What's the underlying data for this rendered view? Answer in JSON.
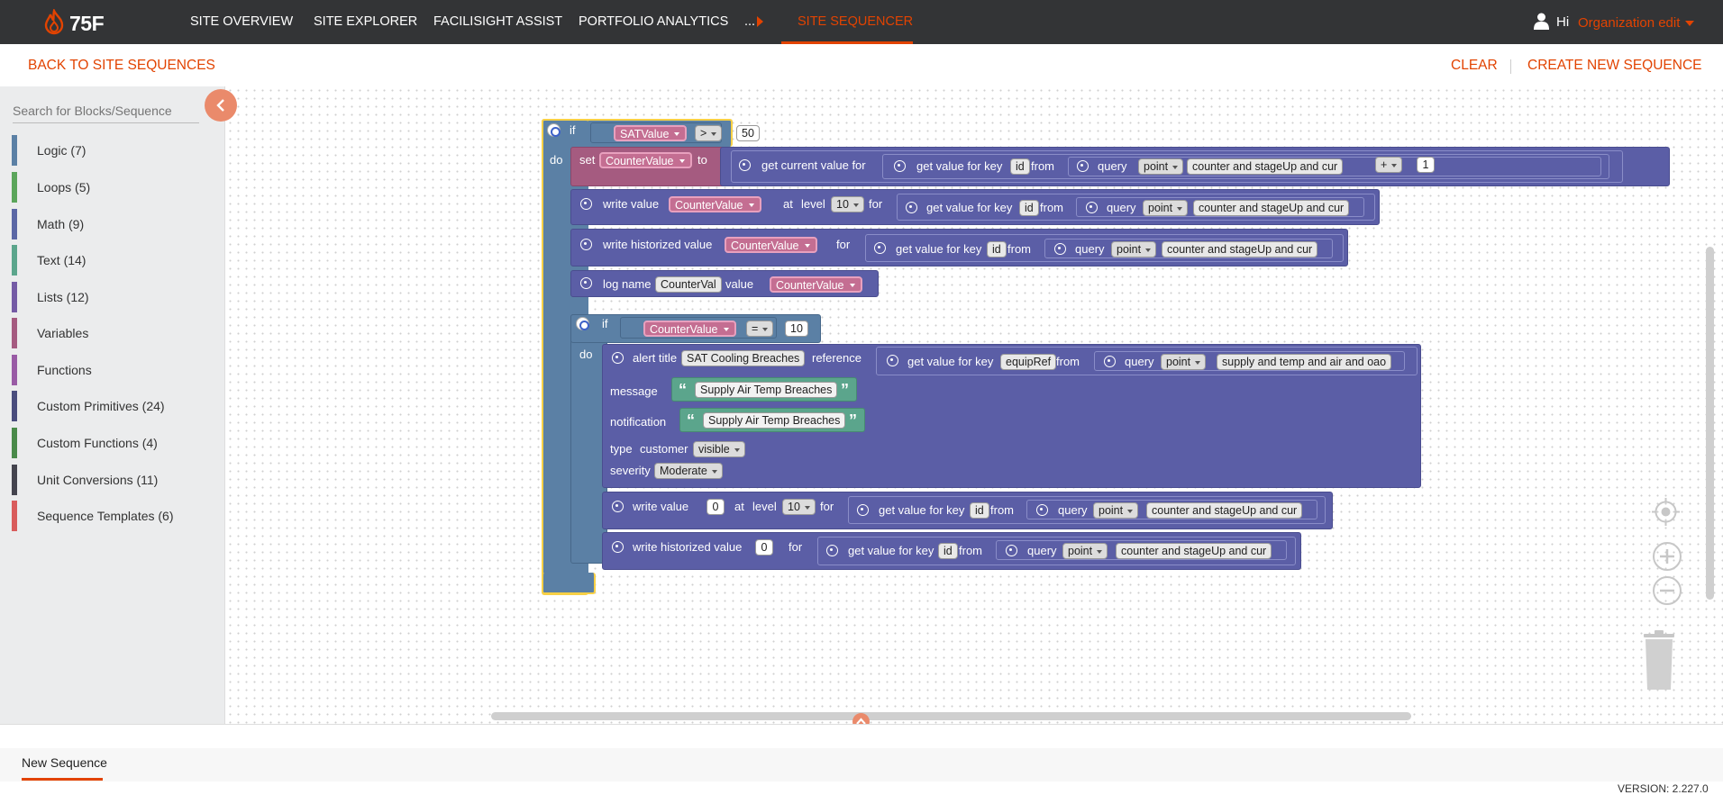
{
  "brand": {
    "name": "75F",
    "accent": "#e24301"
  },
  "nav": {
    "items": [
      "SITE OVERVIEW",
      "SITE EXPLORER",
      "FACILISIGHT ASSIST",
      "PORTFOLIO ANALYTICS",
      "..."
    ],
    "active": "SITE SEQUENCER",
    "user_greeting": "Hi",
    "user_org": "Organization edit"
  },
  "header": {
    "back_link": "BACK TO SITE SEQUENCES",
    "clear": "CLEAR",
    "create_new": "CREATE NEW SEQUENCE"
  },
  "sidebar": {
    "search_placeholder": "Search for Blocks/Sequence",
    "categories": [
      {
        "label": "Logic (7)",
        "color": "#5b80a5"
      },
      {
        "label": "Loops (5)",
        "color": "#5ba55b"
      },
      {
        "label": "Math (9)",
        "color": "#5b67a5"
      },
      {
        "label": "Text (14)",
        "color": "#5ba58c"
      },
      {
        "label": "Lists (12)",
        "color": "#745ba5"
      },
      {
        "label": "Variables",
        "color": "#a55b80"
      },
      {
        "label": "Functions",
        "color": "#995ba5"
      },
      {
        "label": "Custom Primitives (24)",
        "color": "#4a4d7d"
      },
      {
        "label": "Custom Functions (4)",
        "color": "#4a8a4a"
      },
      {
        "label": "Unit Conversions (11)",
        "color": "#44444e"
      },
      {
        "label": "Sequence Templates (6)",
        "color": "#d95c5c"
      }
    ]
  },
  "blocks": {
    "if_kw": "if",
    "do_kw": "do",
    "cond1": {
      "var": "SATValue",
      "op": ">",
      "value": "50"
    },
    "set_kw": "set",
    "set_var": "CounterValue",
    "to_kw": "to",
    "get_current_value_for": "get current value for",
    "get_value_for_key": "get value for key",
    "from_kw": "from",
    "query_kw": "query",
    "key_id": "id",
    "key_equipref": "equipRef",
    "point": "point",
    "q_counter": "counter and stageUp and cur",
    "q_supply": "supply and temp and air and oao",
    "plus": "+",
    "one": "1",
    "write_value": "write value",
    "at_kw": "at",
    "level_kw": "level",
    "level_val": "10",
    "for_kw": "for",
    "write_hist": "write historized value",
    "log_name_kw": "log name",
    "log_name_val": "CounterVal",
    "value_kw": "value",
    "cond2": {
      "var": "CounterValue",
      "op": "=",
      "value": "10"
    },
    "alert_title_kw": "alert title",
    "alert_title_val": "SAT Cooling Breaches",
    "reference_kw": "reference",
    "message_kw": "message",
    "message_val": "Supply Air Temp Breaches",
    "notification_kw": "notification",
    "notification_val": "Supply Air Temp Breaches",
    "type_kw": "type",
    "customer_kw": "customer",
    "visible_val": "visible",
    "severity_kw": "severity",
    "severity_val": "Moderate",
    "zero": "0"
  },
  "footer": {
    "tab": "New Sequence",
    "version": "VERSION: 2.227.0"
  }
}
